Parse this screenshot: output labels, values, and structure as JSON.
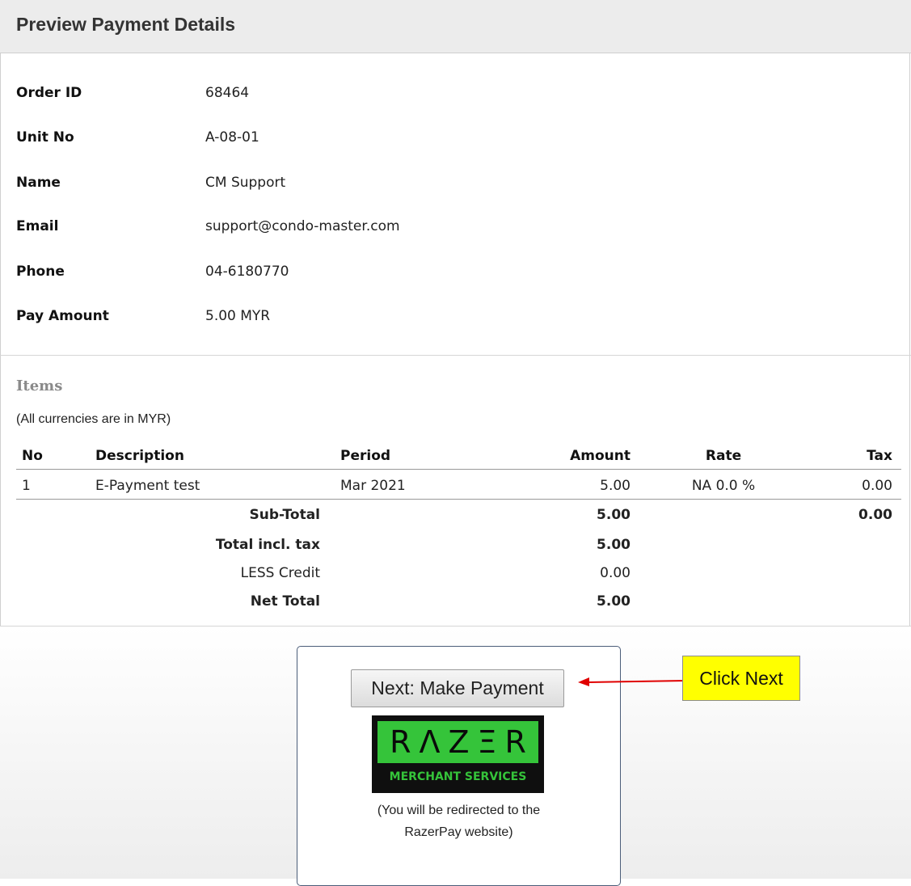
{
  "page": {
    "title": "Preview Payment Details"
  },
  "details": [
    {
      "label": "Order ID",
      "value": "68464"
    },
    {
      "label": "Unit No",
      "value": "A-08-01"
    },
    {
      "label": "Name",
      "value": "CM Support"
    },
    {
      "label": "Email",
      "value": "support@condo-master.com"
    },
    {
      "label": "Phone",
      "value": "04-6180770"
    },
    {
      "label": "Pay Amount",
      "value": "5.00 MYR"
    }
  ],
  "items": {
    "heading": "Items",
    "currency_note": "(All currencies are in MYR)",
    "columns": {
      "no": "No",
      "description": "Description",
      "period": "Period",
      "amount": "Amount",
      "rate": "Rate",
      "tax": "Tax"
    },
    "rows": [
      {
        "no": "1",
        "description": "E-Payment test",
        "period": "Mar 2021",
        "amount": "5.00",
        "rate": "NA 0.0 %",
        "tax": "0.00"
      }
    ],
    "summary": {
      "subtotal_label": "Sub-Total",
      "subtotal_amount": "5.00",
      "subtotal_tax": "0.00",
      "total_label": "Total incl. tax",
      "total_amount": "5.00",
      "credit_label": "LESS Credit",
      "credit_amount": "0.00",
      "net_label": "Net Total",
      "net_amount": "5.00"
    }
  },
  "payment": {
    "next_button": "Next: Make Payment",
    "logo_word": "RΛZΞR",
    "logo_sub": "MERCHANT SERVICES",
    "redirect_line1": "(You will be redirected to the",
    "redirect_line2": "RazerPay website)"
  },
  "annotation": {
    "callout": "Click Next"
  },
  "colors": {
    "header_bg": "#ececec",
    "razer_green": "#35c43a",
    "callout_bg": "#ffff00",
    "arrow": "#e00000"
  }
}
